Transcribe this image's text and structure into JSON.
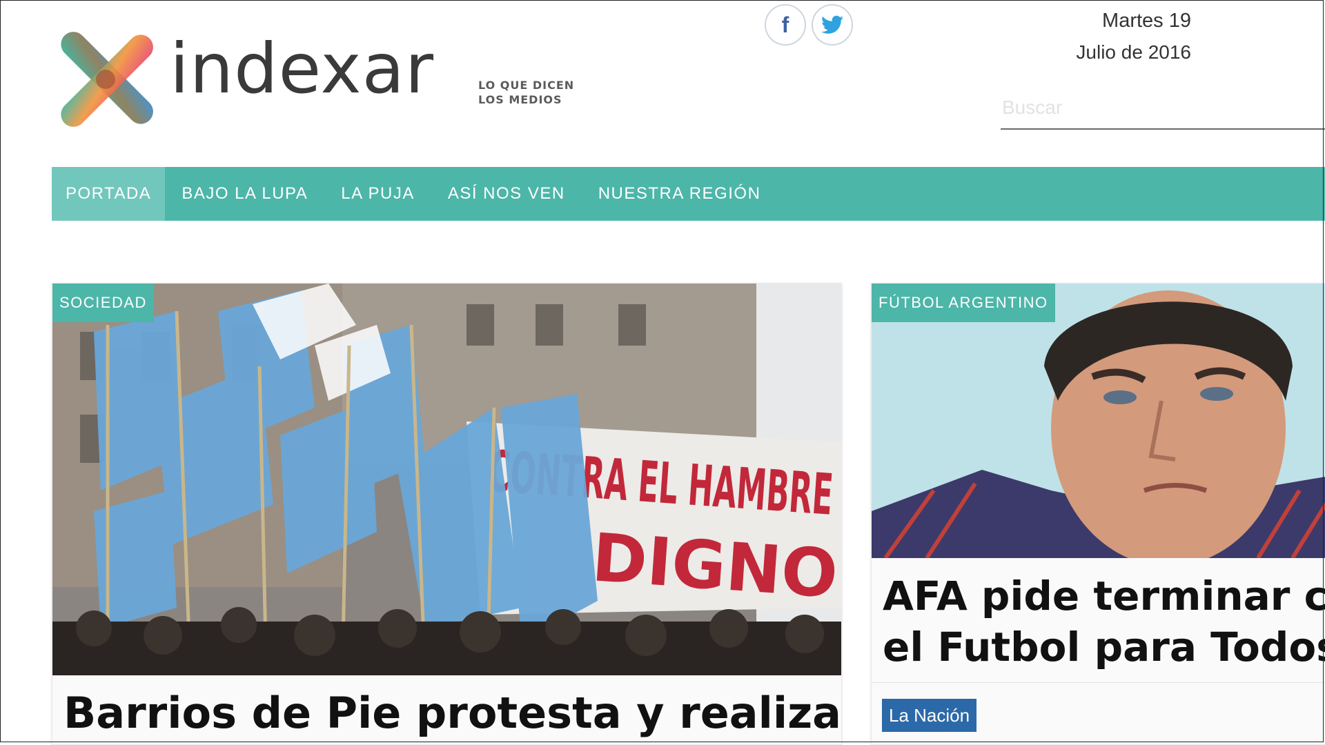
{
  "site": {
    "name": "indexar",
    "tagline_line1": "LO QUE DICEN",
    "tagline_line2": "LOS MEDIOS"
  },
  "social": {
    "facebook_icon": "f",
    "twitter_icon": "twitter-bird-icon"
  },
  "date": {
    "weekday_day": "Martes 19",
    "month_year": "Julio de 2016"
  },
  "search": {
    "placeholder": "Buscar"
  },
  "nav": {
    "items": [
      {
        "label": "PORTADA"
      },
      {
        "label": "BAJO LA LUPA"
      },
      {
        "label": "LA PUJA"
      },
      {
        "label": "ASÍ NOS VEN"
      },
      {
        "label": "NUESTRA REGIÓN"
      }
    ]
  },
  "articles": [
    {
      "category": "SOCIEDAD",
      "headline": "Barrios de Pie protesta y realiza",
      "photo_text_line1": "CONTRA EL HAMBRE",
      "photo_text_line2": "DIGNO"
    },
    {
      "category": "FÚTBOL ARGENTINO",
      "headline_line1": "AFA pide terminar c",
      "headline_line2": "el Futbol para Todos",
      "source": "La Nación"
    }
  ],
  "colors": {
    "nav": "#4cb6a9",
    "nav_active": "#72c7bd",
    "source_badge": "#2c69a8",
    "logo_teal": "#3bb29b",
    "logo_pink": "#e7436b",
    "logo_orange": "#f2933a",
    "logo_blue": "#3f8fc8"
  }
}
